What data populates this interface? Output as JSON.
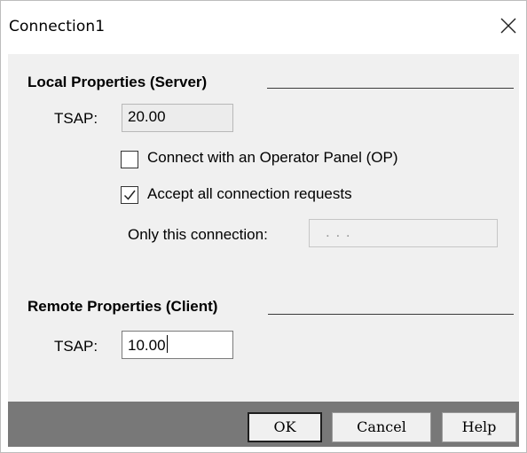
{
  "window": {
    "title": "Connection1",
    "close_icon": "close-icon"
  },
  "local": {
    "header": "Local Properties (Server)",
    "tsap_label": "TSAP:",
    "tsap_value": "20.00",
    "op_checkbox_label": "Connect with an Operator Panel (OP)",
    "op_checked": false,
    "accept_checkbox_label": "Accept all connection requests",
    "accept_checked": true,
    "only_conn_label": "Only this connection:",
    "only_conn_value": ".   .   ."
  },
  "remote": {
    "header": "Remote Properties (Client)",
    "tsap_label": "TSAP:",
    "tsap_value": "10.00"
  },
  "buttons": {
    "ok": "OK",
    "cancel": "Cancel",
    "help": "Help"
  },
  "colors": {
    "panel_bg": "#f0f0f0",
    "footer_bg": "#787878"
  }
}
